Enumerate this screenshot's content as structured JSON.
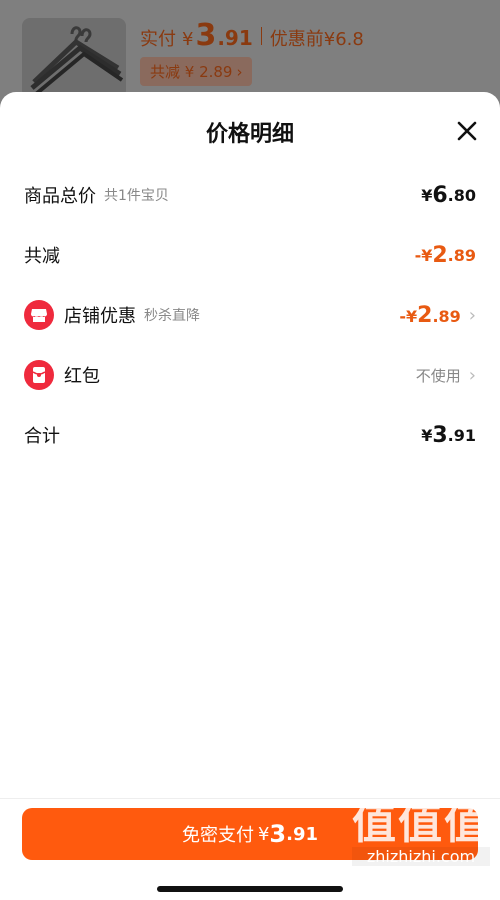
{
  "background": {
    "paid_label": "实付",
    "paid_currency": "¥",
    "paid_integer": "3",
    "paid_decimal": ".91",
    "before_label": "优惠前¥6.8",
    "discount_chip": "共减 ¥ 2.89",
    "chip_chevron": "›"
  },
  "sheet": {
    "title": "价格明细",
    "close_icon": "close-icon"
  },
  "rows": {
    "total": {
      "label": "商品总价",
      "sub": "共1件宝贝",
      "currency": "¥",
      "integer": "6",
      "decimal": ".80"
    },
    "reduce": {
      "label": "共减",
      "currency": "-¥",
      "integer": "2",
      "decimal": ".89"
    },
    "shop": {
      "label": "店铺优惠",
      "sub": "秒杀直降",
      "currency": "-¥",
      "integer": "2",
      "decimal": ".89",
      "chevron": "›"
    },
    "redpacket": {
      "label": "红包",
      "value": "不使用",
      "chevron": "›"
    },
    "sum": {
      "label": "合计",
      "currency": "¥",
      "integer": "3",
      "decimal": ".91"
    }
  },
  "pay_button": {
    "label": "免密支付",
    "currency": "¥",
    "integer": "3",
    "decimal": ".91"
  },
  "watermark": {
    "big": "值值值",
    "small": "zhizhizhi.com"
  },
  "colors": {
    "accent": "#ff5a0e",
    "discount": "#e85a12",
    "icon_red": "#ef2a3d"
  }
}
